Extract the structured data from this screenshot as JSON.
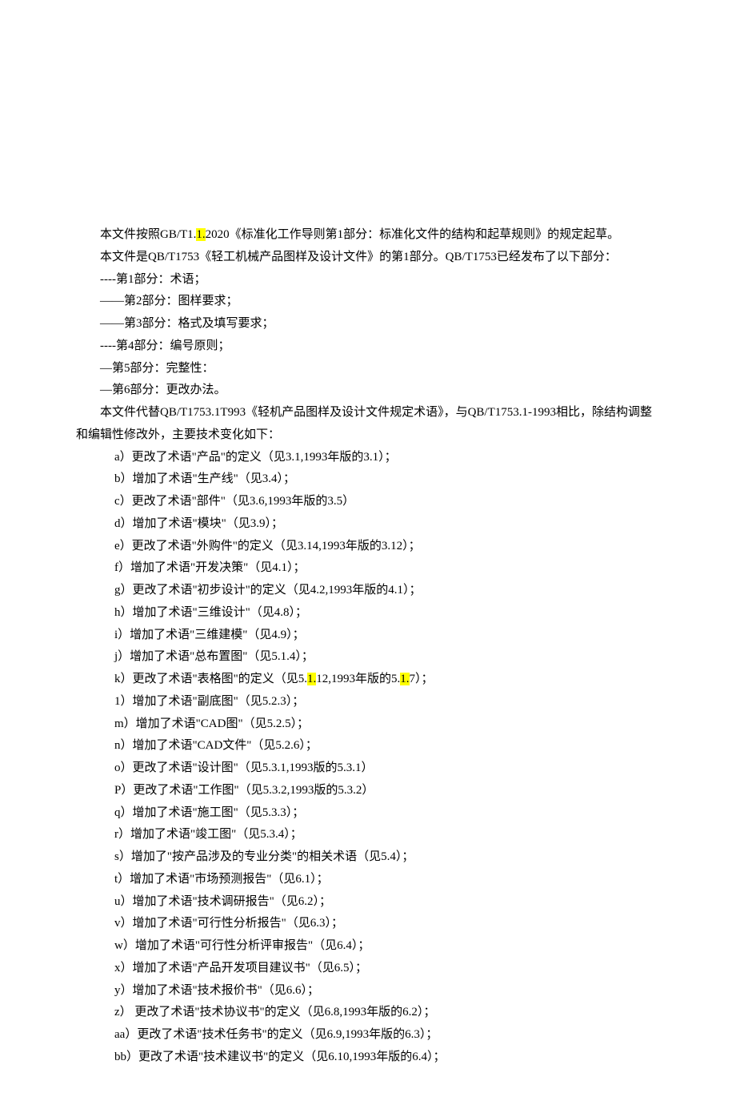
{
  "p1_pre": "本文件按照GB/T1.",
  "p1_hl": "1.",
  "p1_post": "2020《标准化工作导则第1部分：标准化文件的结构和起草规则》的规定起草。",
  "p2": "本文件是QB/T1753《轻工机械产品图样及设计文件》的第1部分。QB/T1753已经发布了以下部分：",
  "parts": [
    "----第1部分：术语；",
    "——第2部分：图样要求；",
    "——第3部分：格式及填写要求；",
    "----第4部分：编号原则；",
    "—第5部分：完整性：",
    "—第6部分：更改办法。"
  ],
  "p3": "本文件代替QB/T1753.1T993《轻机产品图样及设计文件规定术语》，与QB/T1753.1-1993相比，除结构调整和编辑性修改外，主要技术变化如下：",
  "changes_a_j": [
    "a）更改了术语\"产品\"的定义（见3.1,1993年版的3.1）；",
    "b）增加了术语\"生产线\"（见3.4）；",
    "c）更改了术语\"部件\"（见3.6,1993年版的3.5）",
    "d）增加了术语\"模块\"（见3.9）；",
    "e）更改了术语\"外购件\"的定义（见3.14,1993年版的3.12）；",
    "f）增加了术语\"开发决策\"（见4.1）；",
    "g）更改了术语\"初步设计\"的定义（见4.2,1993年版的4.1）；",
    "h）增加了术语\"三维设计\"（见4.8）；",
    "i）增加了术语\"三维建模\"（见4.9）；",
    "j）增加了术语\"总布置图\"（见5.1.4）；"
  ],
  "k_pre": "k）更改了术语\"表格图\"的定义（见5.",
  "k_hl1": "1.",
  "k_mid": "12,1993年版的5.",
  "k_hl2": "1.",
  "k_post": "7）；",
  "changes_l_bb": [
    "1）增加了术语\"副底图\"（见5.2.3）；",
    "m）增加了术语\"CAD图\"（见5.2.5）；",
    "n）增加了术语\"CAD文件\"（见5.2.6）；",
    "o）更改了术语\"设计图\"（见5.3.1,1993版的5.3.1）",
    "P）更改了术语\"工作图\"（见5.3.2,1993版的5.3.2）",
    "q）增加了术语\"施工图\"（见5.3.3）；",
    "r）增加了术语\"竣工图\"（见5.3.4）；",
    "s）增加了\"按产品涉及的专业分类\"的相关术语（见5.4）；",
    "t）增加了术语\"市场预测报告\"（见6.1）；",
    "u）增加了术语\"技术调研报告\"（见6.2）；",
    "v）增加了术语\"可行性分析报告\"（见6.3）；",
    "w）增加了术语\"可行性分析评审报告\"（见6.4）；",
    "x）增加了术语\"产品开发项目建议书\"（见6.5）；",
    "y）增加了术语\"技术报价书\"（见6.6）；",
    "z）   更改了术语\"技术协议书\"的定义（见6.8,1993年版的6.2）；",
    "aa）更改了术语\"技术任务书\"的定义（见6.9,1993年版的6.3）；",
    "bb）更改了术语\"技术建议书\"的定义（见6.10,1993年版的6.4）；"
  ]
}
